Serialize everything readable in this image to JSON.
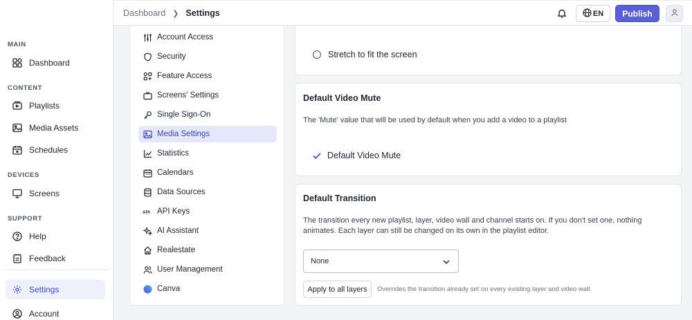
{
  "breadcrumb": {
    "parent": "Dashboard",
    "current": "Settings"
  },
  "topbar": {
    "language": "EN",
    "publish": "Publish"
  },
  "sidebar": {
    "sections": [
      "MAIN",
      "CONTENT",
      "DEVICES",
      "SUPPORT"
    ],
    "items": [
      {
        "label": "Dashboard",
        "icon": "dashboard-icon"
      },
      {
        "label": "Playlists",
        "icon": "playlists-icon"
      },
      {
        "label": "Media Assets",
        "icon": "image-icon"
      },
      {
        "label": "Schedules",
        "icon": "calendar-icon"
      },
      {
        "label": "Screens",
        "icon": "monitor-icon"
      },
      {
        "label": "Help",
        "icon": "help-icon"
      },
      {
        "label": "Feedback",
        "icon": "feedback-icon"
      },
      {
        "label": "Settings",
        "icon": "gear-icon",
        "active": true
      },
      {
        "label": "Account",
        "icon": "account-icon"
      }
    ]
  },
  "settings_nav": {
    "items": [
      {
        "label": "Account Access"
      },
      {
        "label": "Security"
      },
      {
        "label": "Feature Access"
      },
      {
        "label": "Screens' Settings"
      },
      {
        "label": "Single Sign-On"
      },
      {
        "label": "Media Settings",
        "active": true
      },
      {
        "label": "Statistics"
      },
      {
        "label": "Calendars"
      },
      {
        "label": "Data Sources"
      },
      {
        "label": "API Keys"
      },
      {
        "label": "AI Assistant"
      },
      {
        "label": "Realestate"
      },
      {
        "label": "User Management"
      },
      {
        "label": "Canva"
      }
    ]
  },
  "main": {
    "stretch": {
      "label": "Stretch to fit the screen"
    },
    "mute": {
      "title": "Default Video Mute",
      "description": "The 'Mute' value that will be used by default when you add a video to a playlist",
      "checkbox_label": "Default Video Mute"
    },
    "transition": {
      "title": "Default Transition",
      "description_line1": "The transition every new playlist, layer, video wall and channel starts on. If you don't set one, nothing",
      "description_line2": "animates. Each layer can still be changed on its own in the playlist editor.",
      "selected": "None",
      "apply_label": "Apply to all layers",
      "apply_hint": "Overrides the transition already set on every existing layer and video wall."
    }
  },
  "colors": {
    "accent": "#5b5fd6",
    "active_bg": "#e5e8fa",
    "active_text": "#3a46c9"
  }
}
